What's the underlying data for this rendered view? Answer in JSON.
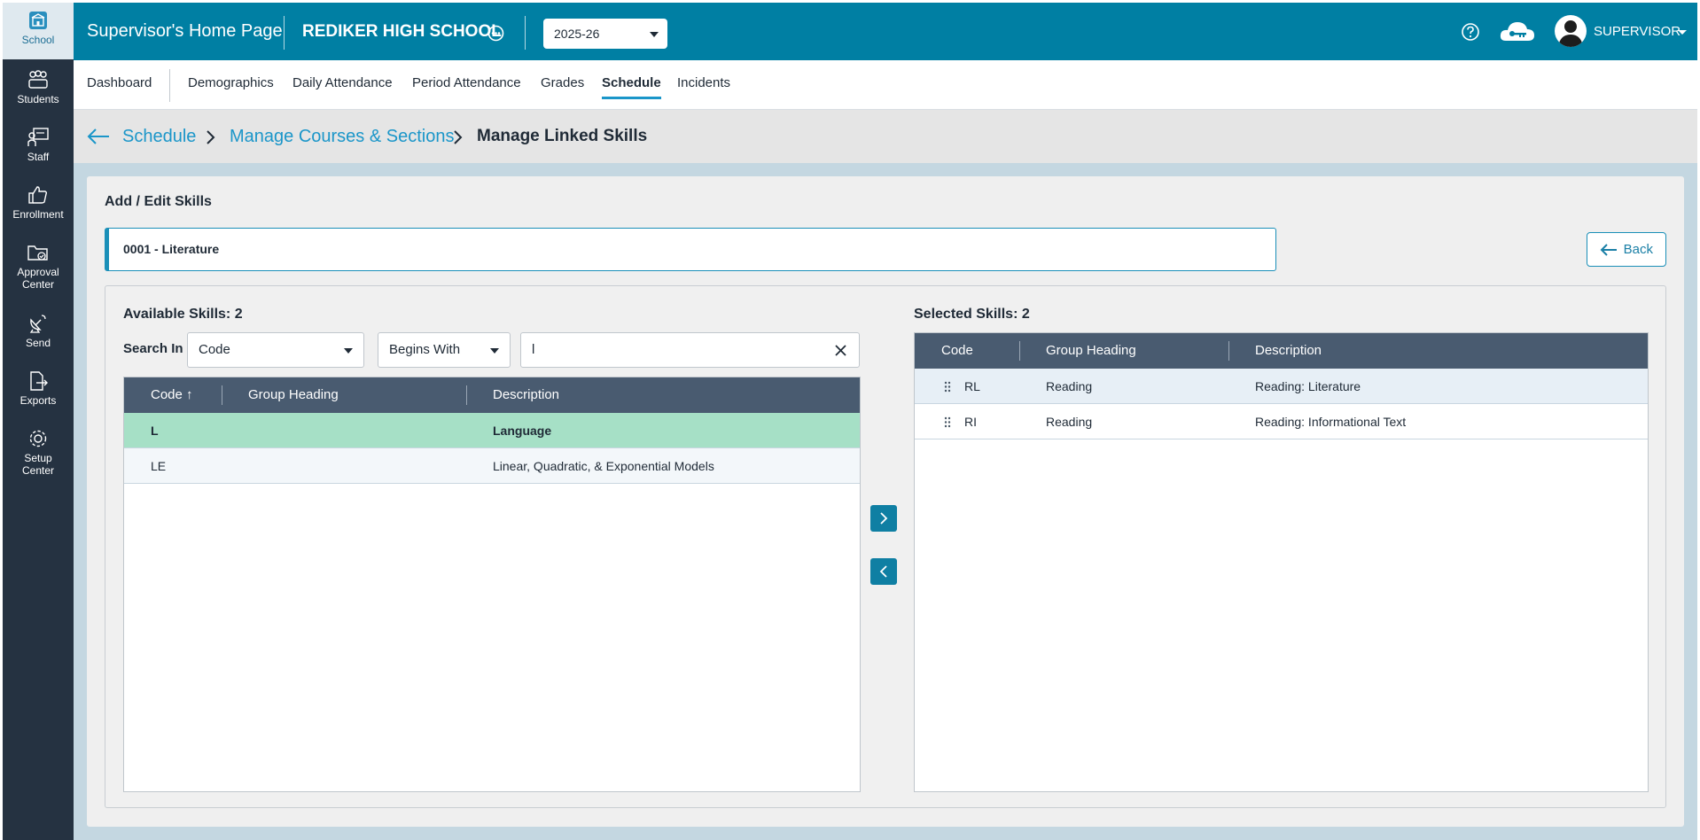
{
  "sidebar": {
    "items": [
      {
        "label": "School",
        "icon": "school-icon"
      },
      {
        "label": "Students",
        "icon": "students-icon"
      },
      {
        "label": "Staff",
        "icon": "staff-icon"
      },
      {
        "label": "Enrollment",
        "icon": "thumbs-up-icon"
      },
      {
        "label": "Approval Center",
        "label_line1": "Approval",
        "label_line2": "Center",
        "icon": "folder-check-icon"
      },
      {
        "label": "Send",
        "icon": "satellite-dish-icon"
      },
      {
        "label": "Exports",
        "icon": "export-file-icon"
      },
      {
        "label": "Setup Center",
        "label_line1": "Setup",
        "label_line2": "Center",
        "icon": "gear-icon"
      }
    ]
  },
  "header": {
    "title": "Supervisor's Home Page",
    "school": "REDIKER HIGH SCHOOL",
    "year": "2025-26",
    "user": "SUPERVISOR",
    "colors": {
      "header_bg": "#007fa3",
      "sidebar_bg": "#253241"
    }
  },
  "tabs": {
    "items": [
      {
        "label": "Dashboard"
      },
      {
        "label": "Demographics"
      },
      {
        "label": "Daily Attendance"
      },
      {
        "label": "Period Attendance"
      },
      {
        "label": "Grades"
      },
      {
        "label": "Schedule"
      },
      {
        "label": "Incidents"
      }
    ],
    "active": "Schedule"
  },
  "breadcrumb": {
    "items": [
      "Schedule",
      "Manage Courses & Sections"
    ],
    "current": "Manage Linked Skills"
  },
  "editor": {
    "title": "Add / Edit Skills",
    "course": "0001 - Literature",
    "back_label": "Back"
  },
  "available": {
    "title": "Available Skills: 2",
    "search_label": "Search In",
    "search_field": "Code",
    "match_mode": "Begins With",
    "search_value": "l",
    "columns": [
      "Code",
      "Group Heading",
      "Description"
    ],
    "rows": [
      {
        "code": "L",
        "group": "",
        "description": "Language"
      },
      {
        "code": "LE",
        "group": "",
        "description": "Linear, Quadratic, & Exponential Models"
      }
    ]
  },
  "selected": {
    "title": "Selected Skills: 2",
    "columns": [
      "Code",
      "Group Heading",
      "Description"
    ],
    "rows": [
      {
        "code": "RL",
        "group": "Reading",
        "description": "Reading: Literature"
      },
      {
        "code": "RI",
        "group": "Reading",
        "description": "Reading: Informational Text"
      }
    ]
  }
}
